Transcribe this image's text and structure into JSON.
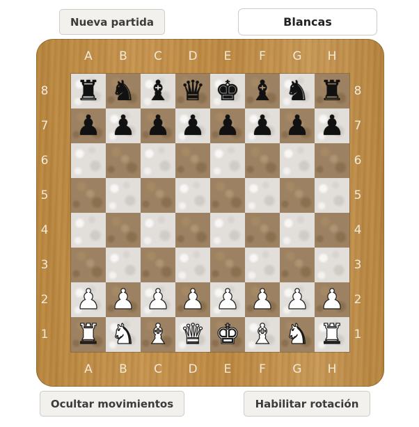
{
  "controls": {
    "new_game": "Nueva partida",
    "player_color": "Blancas",
    "toggle_moves": "Ocultar movimientos",
    "toggle_rotation": "Habilitar rotación"
  },
  "board": {
    "files": [
      "A",
      "B",
      "C",
      "D",
      "E",
      "F",
      "G",
      "H"
    ],
    "ranks": [
      "8",
      "7",
      "6",
      "5",
      "4",
      "3",
      "2",
      "1"
    ],
    "position": [
      [
        "br",
        "bn",
        "bb",
        "bq",
        "bk",
        "bb",
        "bn",
        "br"
      ],
      [
        "bp",
        "bp",
        "bp",
        "bp",
        "bp",
        "bp",
        "bp",
        "bp"
      ],
      [
        "",
        "",
        "",
        "",
        "",
        "",
        "",
        ""
      ],
      [
        "",
        "",
        "",
        "",
        "",
        "",
        "",
        ""
      ],
      [
        "",
        "",
        "",
        "",
        "",
        "",
        "",
        ""
      ],
      [
        "",
        "",
        "",
        "",
        "",
        "",
        "",
        ""
      ],
      [
        "wp",
        "wp",
        "wp",
        "wp",
        "wp",
        "wp",
        "wp",
        "wp"
      ],
      [
        "wr",
        "wn",
        "wb",
        "wq",
        "wk",
        "wb",
        "wn",
        "wr"
      ]
    ],
    "piece_icons": {
      "k": "king-icon",
      "q": "queen-icon",
      "r": "rook-icon",
      "b": "bishop-icon",
      "n": "knight-icon",
      "p": "pawn-icon"
    },
    "colors": {
      "light_square": "#e2dfdb",
      "dark_square": "#9c8262",
      "frame": "#c08c48",
      "coordinates": "#f4ead8"
    }
  }
}
